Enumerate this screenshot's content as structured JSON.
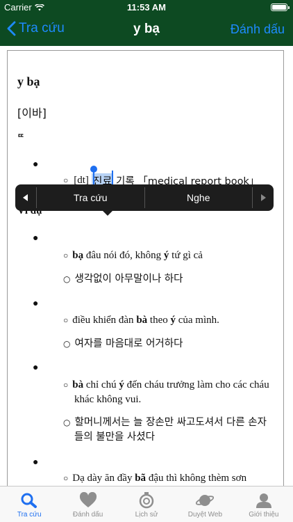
{
  "status_bar": {
    "carrier": "Carrier",
    "time": "11:53 AM"
  },
  "nav": {
    "back_label": "Tra cứu",
    "title": "y bạ",
    "action_label": "Đánh dấu"
  },
  "entry": {
    "headword": "y bạ",
    "hanja": "[이바]",
    "pos": "ᄄ",
    "definition": {
      "prefix": "[dt]",
      "selected": "진료",
      "rest": "기록 「medical report book」"
    },
    "examples_heading": "Ví dụ",
    "examples": [
      {
        "vi": [
          "bạ",
          " đâu nói đó, không ",
          "ý",
          " tứ gì cả"
        ],
        "ko": "생각없이 아무말이나 하다"
      },
      {
        "vi": [
          "điều khiển đàn ",
          "bà",
          " theo ",
          "ý",
          " của mình."
        ],
        "ko": "여자를 마음대로 어거하다"
      },
      {
        "vi": [
          "bà",
          " chỉ chú ",
          "ý",
          " đến cháu trưởng làm cho các cháu khác không vui."
        ],
        "ko": "할머니께서는 늘 장손만 싸고도셔서 다른 손자들의 불만을 사셨다"
      },
      {
        "vi": [
          "Dạ dày ăn đầy ",
          "bã",
          " đậu thì không thèm sơn"
        ]
      }
    ]
  },
  "context_menu": {
    "items": [
      "Tra cứu",
      "Nghe"
    ]
  },
  "tabs": [
    {
      "label": "Tra cứu",
      "icon": "search-icon",
      "active": true
    },
    {
      "label": "Đánh dấu",
      "icon": "heart-icon",
      "active": false
    },
    {
      "label": "Lịch sử",
      "icon": "history-icon",
      "active": false
    },
    {
      "label": "Duyệt Web",
      "icon": "planet-icon",
      "active": false
    },
    {
      "label": "Giới thiệu",
      "icon": "person-icon",
      "active": false
    }
  ],
  "colors": {
    "nav_bg": "#0d4a22",
    "accent": "#1e8bff",
    "selection": "#b8d3f5"
  }
}
